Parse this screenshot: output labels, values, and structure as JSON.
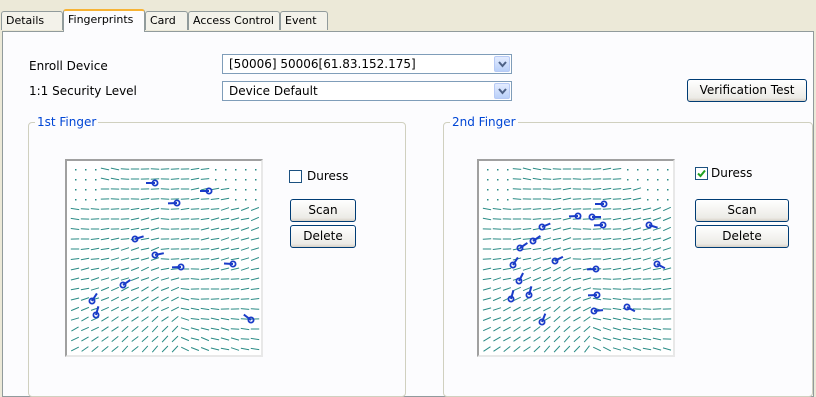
{
  "tabs": [
    "Details",
    "Fingerprints",
    "Card",
    "Access Control",
    "Event"
  ],
  "active_tab": "Fingerprints",
  "enroll_device": {
    "label": "Enroll Device",
    "value": "[50006] 50006[61.83.152.175]"
  },
  "security_level": {
    "label": "1:1 Security Level",
    "value": "Device Default"
  },
  "verification_button": "Verification Test",
  "fingers": [
    {
      "legend": "1st Finger",
      "duress_label": "Duress",
      "duress_checked": false,
      "scan_label": "Scan",
      "delete_label": "Delete"
    },
    {
      "legend": "2nd Finger",
      "duress_label": "Duress",
      "duress_checked": true,
      "scan_label": "Scan",
      "delete_label": "Delete"
    }
  ],
  "colors": {
    "ridge": "#2a8b85",
    "minutiae": "#1a3cc8",
    "accent_tab": "#f7b335"
  }
}
